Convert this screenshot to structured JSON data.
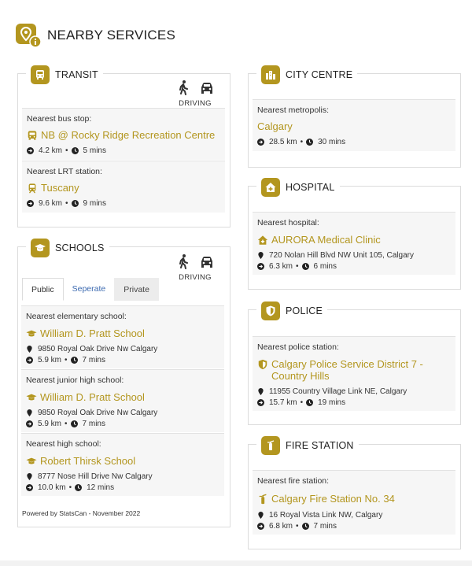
{
  "page": {
    "title": "NEARBY SERVICES",
    "accent": "#b3961f"
  },
  "transit": {
    "title": "TRANSIT",
    "mode_label": "DRIVING",
    "items": [
      {
        "caption": "Nearest bus stop:",
        "name": "NB @ Rocky Ridge Recreation Centre",
        "distance": "4.2 km",
        "time": "5 mins"
      },
      {
        "caption": "Nearest LRT station:",
        "name": "Tuscany",
        "distance": "9.6 km",
        "time": "9 mins"
      }
    ]
  },
  "schools": {
    "title": "SCHOOLS",
    "mode_label": "DRIVING",
    "tabs": [
      "Public",
      "Seperate",
      "Private"
    ],
    "items": [
      {
        "caption": "Nearest elementary school:",
        "name": "William D. Pratt School",
        "address": "9850 Royal Oak Drive Nw Calgary",
        "distance": "5.9 km",
        "time": "7 mins"
      },
      {
        "caption": "Nearest junior high school:",
        "name": "William D. Pratt School",
        "address": "9850 Royal Oak Drive Nw Calgary",
        "distance": "5.9 km",
        "time": "7 mins"
      },
      {
        "caption": "Nearest high school:",
        "name": "Robert Thirsk School",
        "address": "8777 Nose Hill Drive Nw Calgary",
        "distance": "10.0 km",
        "time": "12 mins"
      }
    ],
    "footer": "Powered by StatsCan - November 2022"
  },
  "city": {
    "title": "CITY CENTRE",
    "caption": "Nearest metropolis:",
    "name": "Calgary",
    "distance": "28.5 km",
    "time": "30 mins"
  },
  "hospital": {
    "title": "HOSPITAL",
    "caption": "Nearest hospital:",
    "name": "AURORA Medical Clinic",
    "address": "720 Nolan Hill Blvd NW Unit 105, Calgary",
    "distance": "6.3 km",
    "time": "6 mins"
  },
  "police": {
    "title": "POLICE",
    "caption": "Nearest police station:",
    "name_line1": "Calgary Police Service District 7 -",
    "name_line2": "Country Hills",
    "address": "11955 Country Village Link NE, Calgary",
    "distance": "15.7 km",
    "time": "19 mins"
  },
  "fire": {
    "title": "FIRE STATION",
    "caption": "Nearest fire station:",
    "name": "Calgary Fire Station No. 34",
    "address": "16 Royal Vista Link NW, Calgary",
    "distance": "6.8 km",
    "time": "7 mins"
  },
  "separator": "•"
}
